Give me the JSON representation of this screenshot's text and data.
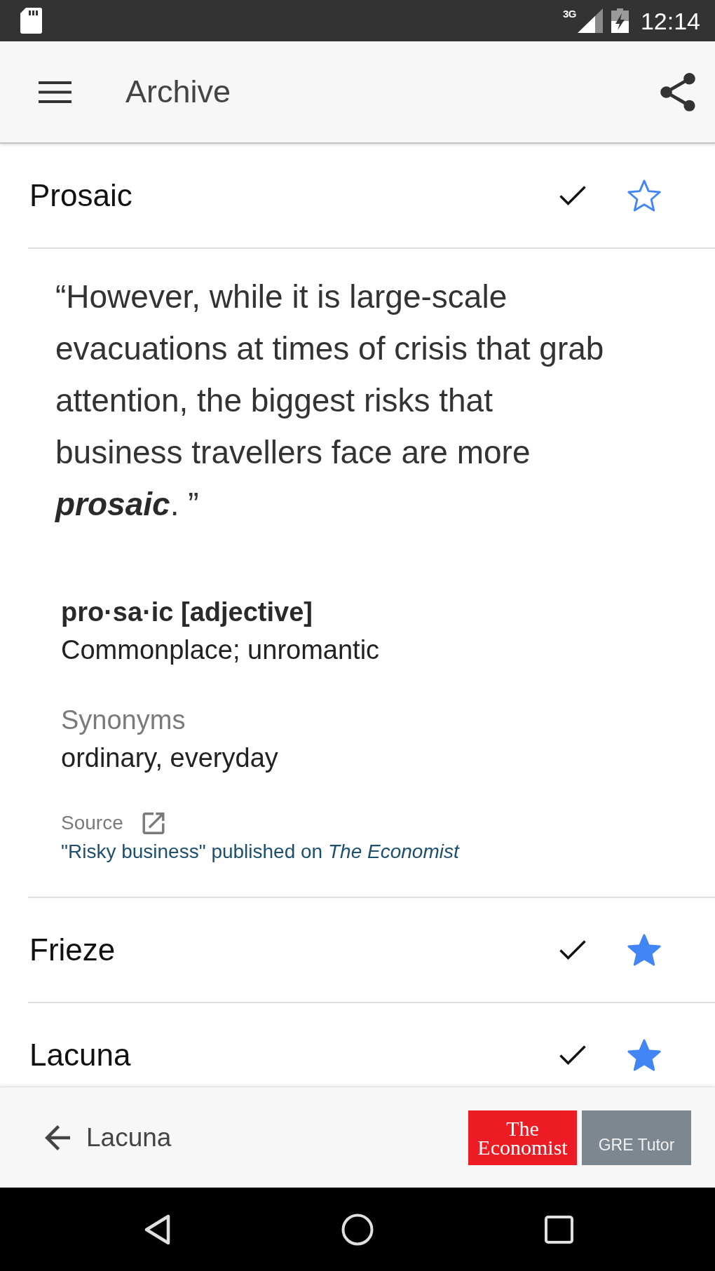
{
  "status_bar": {
    "network": "3G",
    "time": "12:14"
  },
  "app_bar": {
    "title": "Archive"
  },
  "words": [
    {
      "word": "Prosaic",
      "checked": true,
      "starred": false,
      "details": {
        "quote": "“However, while it is large-scale evacuations at times of crisis that grab attention, the biggest risks that business travellers face are more **prosaic**. ”",
        "headword": "pro·sa·ic [adjective]",
        "meaning": "Commonplace; unromantic",
        "synonyms_label": "Synonyms",
        "synonyms": "ordinary, everyday",
        "source_label": "Source",
        "source": "\"Risky business\" published on *The Economist*"
      }
    },
    {
      "word": "Frieze",
      "checked": true,
      "starred": true
    },
    {
      "word": "Lacuna",
      "checked": true,
      "starred": true
    }
  ],
  "bottom_bar": {
    "previous": "Lacuna",
    "logo_lines": [
      "The",
      "Economist"
    ],
    "product": "GRE Tutor"
  }
}
